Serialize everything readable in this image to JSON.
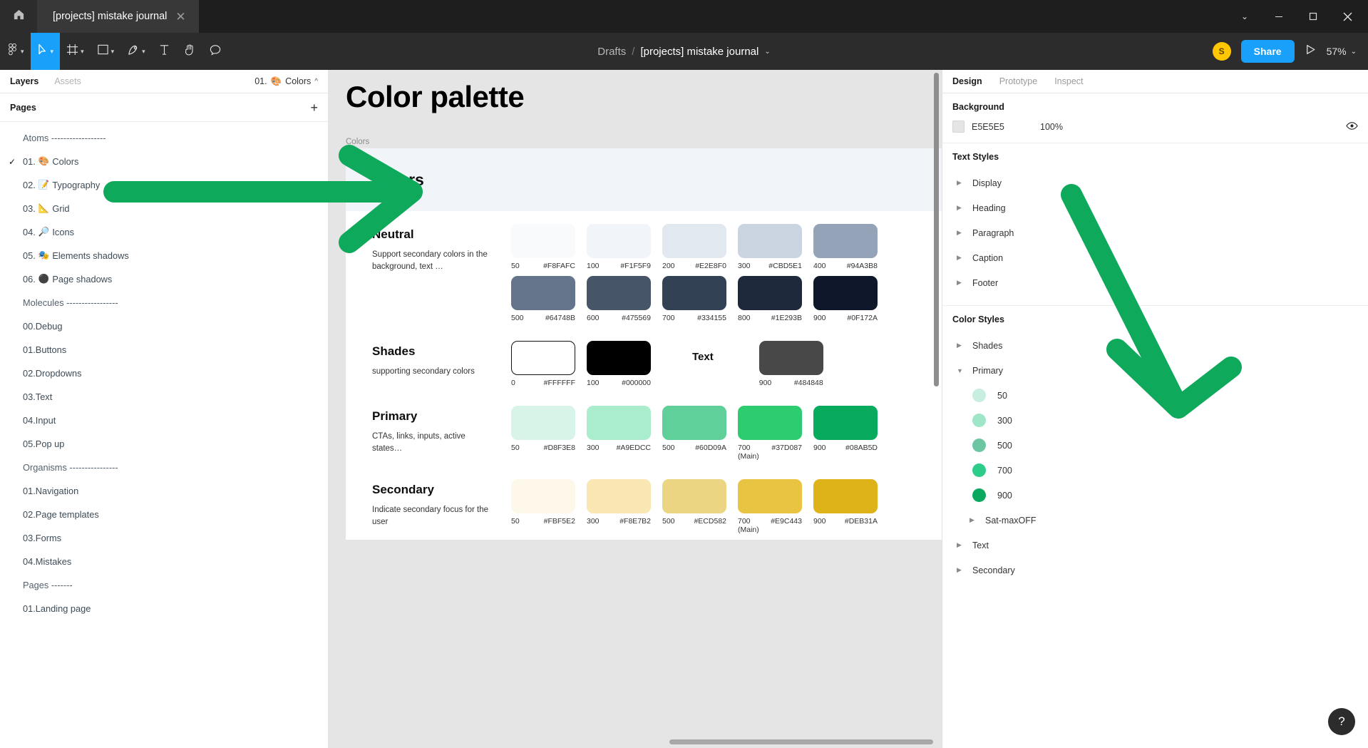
{
  "titlebar": {
    "home_icon": "home-icon",
    "tab_title": "[projects] mistake journal",
    "close_glyph": "✕",
    "chevron_glyph": "⌄",
    "minimize_glyph": "—",
    "maximize_glyph": "▢",
    "window_close_glyph": "✕"
  },
  "toolbar": {
    "menu_icon": "figma-logo-icon",
    "move_icon": "cursor-move-icon",
    "frame_icon": "frame-icon",
    "shape_icon": "rectangle-icon",
    "pen_icon": "pen-icon",
    "text_icon": "text-icon",
    "hand_icon": "hand-icon",
    "comment_icon": "comment-icon",
    "breadcrumb_drafts": "Drafts",
    "breadcrumb_sep": "/",
    "breadcrumb_file": "[projects] mistake journal",
    "breadcrumb_caret": "⌄",
    "avatar_initial": "S",
    "share_label": "Share",
    "present_icon": "play-icon",
    "zoom_level": "57%",
    "zoom_caret": "⌄"
  },
  "left_panel": {
    "tabs": [
      {
        "label": "Layers",
        "active": true
      },
      {
        "label": "Assets",
        "active": false
      }
    ],
    "current_page": "01.",
    "current_page_emoji": "🎨",
    "current_page_name": "Colors",
    "current_page_caret": "^",
    "pages_header": "Pages",
    "add_page_glyph": "+",
    "pages": [
      {
        "check": "",
        "num": "",
        "emoji": "",
        "label": "Atoms ------------------",
        "divider": true
      },
      {
        "check": "✓",
        "num": "01.",
        "emoji": "🎨",
        "label": "Colors",
        "divider": false
      },
      {
        "check": "",
        "num": "02.",
        "emoji": "📝",
        "label": "Typography",
        "divider": false
      },
      {
        "check": "",
        "num": "03.",
        "emoji": "📐",
        "label": "Grid",
        "divider": false
      },
      {
        "check": "",
        "num": "04.",
        "emoji": "🔎",
        "label": "Icons",
        "divider": false
      },
      {
        "check": "",
        "num": "05.",
        "emoji": "🎭",
        "label": "Elements shadows",
        "divider": false
      },
      {
        "check": "",
        "num": "06.",
        "emoji": "⚫",
        "label": "Page shadows",
        "divider": false
      },
      {
        "check": "",
        "num": "",
        "emoji": "",
        "label": "Molecules -----------------",
        "divider": true
      },
      {
        "check": "",
        "num": "00.",
        "emoji": "",
        "label": "Debug",
        "divider": false
      },
      {
        "check": "",
        "num": "01.",
        "emoji": "",
        "label": "Buttons",
        "divider": false
      },
      {
        "check": "",
        "num": "02.",
        "emoji": "",
        "label": "Dropdowns",
        "divider": false
      },
      {
        "check": "",
        "num": "03.",
        "emoji": "",
        "label": "Text",
        "divider": false
      },
      {
        "check": "",
        "num": "04.",
        "emoji": "",
        "label": "Input",
        "divider": false
      },
      {
        "check": "",
        "num": "05.",
        "emoji": "",
        "label": "Pop up",
        "divider": false
      },
      {
        "check": "",
        "num": "",
        "emoji": "",
        "label": "Organisms ----------------",
        "divider": true
      },
      {
        "check": "",
        "num": "01.",
        "emoji": "",
        "label": "Navigation",
        "divider": false
      },
      {
        "check": "",
        "num": "02.",
        "emoji": "",
        "label": "Page templates",
        "divider": false
      },
      {
        "check": "",
        "num": "03.",
        "emoji": "",
        "label": "Forms",
        "divider": false
      },
      {
        "check": "",
        "num": "04.",
        "emoji": "",
        "label": "Mistakes",
        "divider": false
      },
      {
        "check": "",
        "num": "",
        "emoji": "",
        "label": "Pages -------",
        "divider": true
      },
      {
        "check": "",
        "num": "01.",
        "emoji": "",
        "label": "Landing page",
        "divider": false
      }
    ]
  },
  "canvas": {
    "page_title": "Color palette",
    "frame_label": "Colors",
    "frame_heading": "Colors",
    "sections": [
      {
        "name": "Neutral",
        "description": "Support secondary colors in the background, text …",
        "rows": [
          [
            {
              "name": "50",
              "hex": "#F8FAFC",
              "color": "#F8FAFC"
            },
            {
              "name": "100",
              "hex": "#F1F5F9",
              "color": "#F1F5F9"
            },
            {
              "name": "200",
              "hex": "#E2E8F0",
              "color": "#E2E8F0"
            },
            {
              "name": "300",
              "hex": "#CBD5E1",
              "color": "#CBD5E1"
            },
            {
              "name": "400",
              "hex": "#94A3B8",
              "color": "#94A3B8"
            }
          ],
          [
            {
              "name": "500",
              "hex": "#64748B",
              "color": "#64748B"
            },
            {
              "name": "600",
              "hex": "#475569",
              "color": "#475569"
            },
            {
              "name": "700",
              "hex": "#334155",
              "color": "#334155"
            },
            {
              "name": "800",
              "hex": "#1E293B",
              "color": "#1E293B"
            },
            {
              "name": "900",
              "hex": "#0F172A",
              "color": "#0F172A"
            }
          ]
        ]
      },
      {
        "name": "Shades",
        "description": "supporting secondary colors",
        "rows": [
          [
            {
              "name": "0",
              "hex": "#FFFFFF",
              "color": "#FFFFFF",
              "outlined": true
            },
            {
              "name": "100",
              "hex": "#000000",
              "color": "#000000"
            }
          ]
        ],
        "extra_label": "Text",
        "extra": [
          {
            "name": "900",
            "hex": "#484848",
            "color": "#484848"
          }
        ]
      },
      {
        "name": "Primary",
        "description": "CTAs, links, inputs, active states…",
        "rows": [
          [
            {
              "name": "50",
              "hex": "#D8F3E8",
              "color": "#D8F3E8"
            },
            {
              "name": "300",
              "hex": "#A9EDCC",
              "color": "#A9EDCC"
            },
            {
              "name": "500",
              "hex": "#60D09A",
              "color": "#60D09A"
            },
            {
              "name": "700 (Main)",
              "hex": "#37D087",
              "color": "#2ECC71"
            },
            {
              "name": "900",
              "hex": "#08AB5D",
              "color": "#08AB5D"
            }
          ]
        ]
      },
      {
        "name": "Secondary",
        "description": "Indicate secondary focus for the user",
        "rows": [
          [
            {
              "name": "50",
              "hex": "#FBF5E2",
              "color": "#FDF8EA"
            },
            {
              "name": "300",
              "hex": "#F8E7B2",
              "color": "#F8E7B2"
            },
            {
              "name": "500",
              "hex": "#ECD582",
              "color": "#ECD582"
            },
            {
              "name": "700 (Main)",
              "hex": "#E9C443",
              "color": "#E9C443"
            },
            {
              "name": "900",
              "hex": "#DEB31A",
              "color": "#DEB31A"
            }
          ]
        ]
      }
    ]
  },
  "right_panel": {
    "tabs": [
      {
        "label": "Design",
        "active": true
      },
      {
        "label": "Prototype",
        "active": false
      },
      {
        "label": "Inspect",
        "active": false
      }
    ],
    "background": {
      "heading": "Background",
      "hex": "E5E5E5",
      "swatch_color": "#E5E5E5",
      "opacity": "100%",
      "visibility_icon": "eye-icon"
    },
    "text_styles": {
      "heading": "Text Styles",
      "items": [
        {
          "label": "Display",
          "tri": "▶"
        },
        {
          "label": "Heading",
          "tri": "▶"
        },
        {
          "label": "Paragraph",
          "tri": "▶"
        },
        {
          "label": "Caption",
          "tri": "▶"
        },
        {
          "label": "Footer",
          "tri": "▶"
        }
      ]
    },
    "color_styles": {
      "heading": "Color Styles",
      "items": [
        {
          "label": "Shades",
          "tri": "▶",
          "type": "group",
          "nested": false
        },
        {
          "label": "Primary",
          "tri": "▼",
          "type": "group",
          "nested": false
        },
        {
          "label": "50",
          "type": "swatch",
          "color": "#C7EEDE",
          "nested": true
        },
        {
          "label": "300",
          "type": "swatch",
          "color": "#9FE6C8",
          "nested": true
        },
        {
          "label": "500",
          "type": "swatch",
          "color": "#6CC6A4",
          "nested": true
        },
        {
          "label": "700",
          "type": "swatch",
          "color": "#2ECC8B",
          "nested": true
        },
        {
          "label": "900",
          "type": "swatch",
          "color": "#0BA95F",
          "nested": true
        },
        {
          "label": "Sat-maxOFF",
          "tri": "▶",
          "type": "group",
          "nested": true
        },
        {
          "label": "Text",
          "tri": "▶",
          "type": "group",
          "nested": false
        },
        {
          "label": "Secondary",
          "tri": "▶",
          "type": "group",
          "nested": false
        }
      ]
    },
    "help_glyph": "?"
  },
  "colors": {
    "accent_blue": "#18a0fb",
    "annotation_green": "#0fa95c",
    "titlebar_bg": "#1e1e1e",
    "toolbar_bg": "#2c2c2c"
  }
}
